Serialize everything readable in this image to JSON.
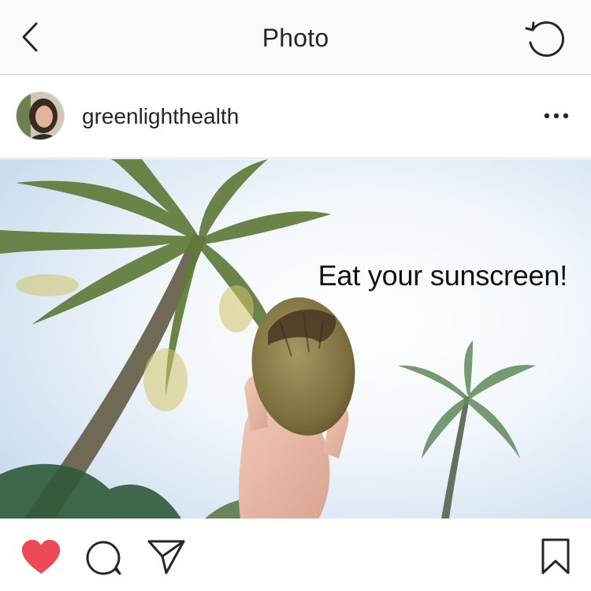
{
  "nav": {
    "title": "Photo",
    "back_icon": "chevron-left-icon",
    "refresh_icon": "refresh-icon"
  },
  "post": {
    "username": "greenlighthealth",
    "more_icon": "more-options-icon",
    "image_caption": "Eat your sunscreen!",
    "liked": true
  },
  "actions": {
    "like_icon": "heart-icon",
    "comment_icon": "comment-icon",
    "share_icon": "send-icon",
    "save_icon": "bookmark-icon"
  },
  "colors": {
    "like_red": "#ed4956",
    "text": "#262626"
  }
}
